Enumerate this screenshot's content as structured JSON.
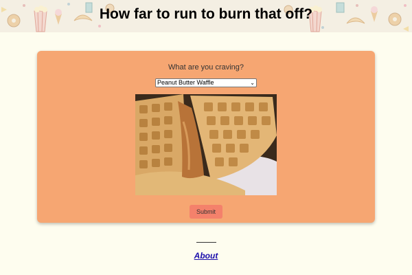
{
  "page": {
    "title": "How far to run to burn that off?"
  },
  "form": {
    "question": "What are you craving?",
    "selected_food": "Peanut Butter Waffle",
    "submit_label": "Submit"
  },
  "footer": {
    "about_label": "About"
  },
  "colors": {
    "background": "#fefdef",
    "card": "#f6a672",
    "submit": "#f4816b",
    "link": "#1a0dab"
  },
  "icons": {
    "header": "snack-pattern-icons",
    "dropdown": "chevron-down-icon"
  }
}
